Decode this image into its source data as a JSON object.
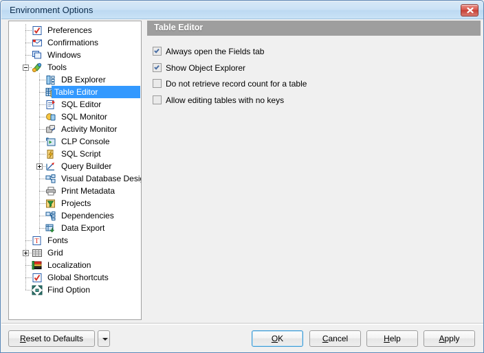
{
  "window": {
    "title": "Environment Options",
    "close_label": "✕",
    "close_icon": "close-icon"
  },
  "tree": {
    "nodes": [
      {
        "label": "Preferences",
        "icon": "preferences-icon",
        "depth": 1,
        "expander": "none",
        "selected": false
      },
      {
        "label": "Confirmations",
        "icon": "confirmations-icon",
        "depth": 1,
        "expander": "none",
        "selected": false
      },
      {
        "label": "Windows",
        "icon": "windows-icon",
        "depth": 1,
        "expander": "none",
        "selected": false
      },
      {
        "label": "Tools",
        "icon": "tools-icon",
        "depth": 1,
        "expander": "minus",
        "selected": false
      },
      {
        "label": "DB Explorer",
        "icon": "db-explorer-icon",
        "depth": 2,
        "expander": "none",
        "selected": false
      },
      {
        "label": "Table Editor",
        "icon": "table-editor-icon",
        "depth": 2,
        "expander": "none",
        "selected": true
      },
      {
        "label": "SQL Editor",
        "icon": "sql-editor-icon",
        "depth": 2,
        "expander": "none",
        "selected": false
      },
      {
        "label": "SQL Monitor",
        "icon": "sql-monitor-icon",
        "depth": 2,
        "expander": "none",
        "selected": false
      },
      {
        "label": "Activity Monitor",
        "icon": "activity-monitor-icon",
        "depth": 2,
        "expander": "none",
        "selected": false
      },
      {
        "label": "CLP Console",
        "icon": "clp-console-icon",
        "depth": 2,
        "expander": "none",
        "selected": false
      },
      {
        "label": "SQL Script",
        "icon": "sql-script-icon",
        "depth": 2,
        "expander": "none",
        "selected": false
      },
      {
        "label": "Query Builder",
        "icon": "query-builder-icon",
        "depth": 2,
        "expander": "plus",
        "selected": false
      },
      {
        "label": "Visual Database Designer",
        "icon": "vdb-designer-icon",
        "depth": 2,
        "expander": "none",
        "selected": false
      },
      {
        "label": "Print Metadata",
        "icon": "print-metadata-icon",
        "depth": 2,
        "expander": "none",
        "selected": false
      },
      {
        "label": "Projects",
        "icon": "projects-icon",
        "depth": 2,
        "expander": "none",
        "selected": false
      },
      {
        "label": "Dependencies",
        "icon": "dependencies-icon",
        "depth": 2,
        "expander": "none",
        "selected": false
      },
      {
        "label": "Data Export",
        "icon": "data-export-icon",
        "depth": 2,
        "expander": "none",
        "selected": false
      },
      {
        "label": "Fonts",
        "icon": "fonts-icon",
        "depth": 1,
        "expander": "none",
        "selected": false
      },
      {
        "label": "Grid",
        "icon": "grid-icon",
        "depth": 1,
        "expander": "plus",
        "selected": false
      },
      {
        "label": "Localization",
        "icon": "localization-icon",
        "depth": 1,
        "expander": "none",
        "selected": false
      },
      {
        "label": "Global Shortcuts",
        "icon": "global-shortcuts-icon",
        "depth": 1,
        "expander": "none",
        "selected": false
      },
      {
        "label": "Find Option",
        "icon": "find-option-icon",
        "depth": 1,
        "expander": "none",
        "selected": false
      }
    ]
  },
  "panel": {
    "header": "Table Editor",
    "options": [
      {
        "label": "Always open the Fields tab",
        "checked": true
      },
      {
        "label": "Show Object Explorer",
        "checked": true
      },
      {
        "label": "Do not retrieve record count for a table",
        "checked": false
      },
      {
        "label": "Allow editing tables with no keys",
        "checked": false
      }
    ]
  },
  "footer": {
    "reset": {
      "pre": "",
      "accel": "R",
      "post": "eset to Defaults"
    },
    "reset_full": "Reset to Defaults",
    "dropdown_icon": "chevron-down-icon",
    "buttons": [
      {
        "pre": "",
        "accel": "O",
        "post": "K",
        "full": "OK",
        "focused": true
      },
      {
        "pre": "",
        "accel": "C",
        "post": "ancel",
        "full": "Cancel",
        "focused": false
      },
      {
        "pre": "",
        "accel": "H",
        "post": "elp",
        "full": "Help",
        "focused": false
      },
      {
        "pre": "",
        "accel": "A",
        "post": "pply",
        "full": "Apply",
        "focused": false
      }
    ]
  },
  "colors": {
    "selection": "#3399ff",
    "section_header": "#9e9e9e",
    "title_bar": "#c9e2f6",
    "close_button": "#c63f35"
  }
}
